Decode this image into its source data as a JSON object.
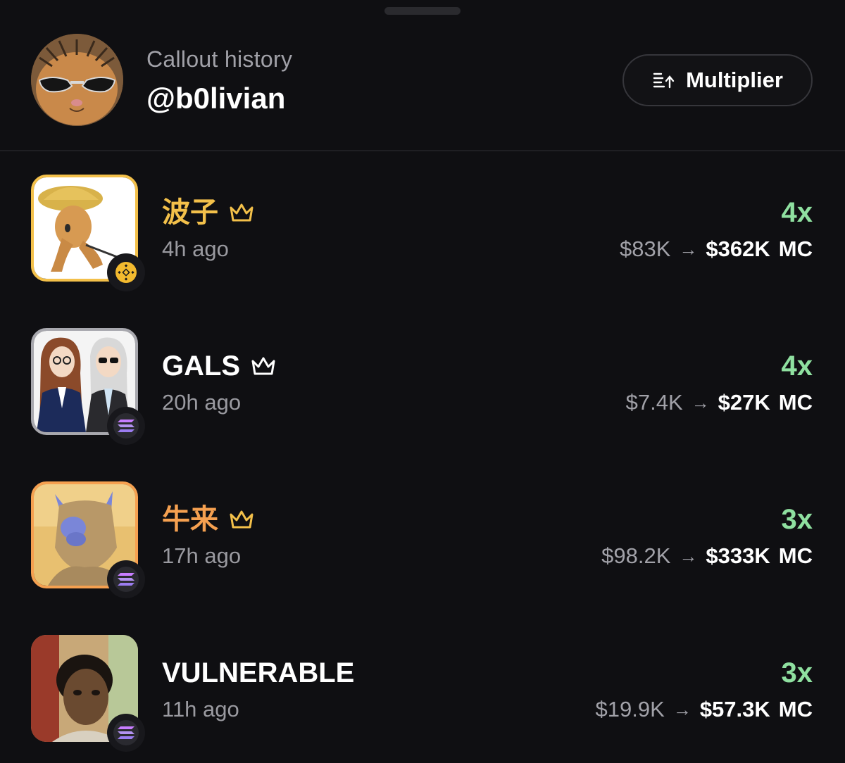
{
  "header": {
    "subtitle": "Callout history",
    "username": "@b0livian",
    "multiplier_button": "Multiplier"
  },
  "colors": {
    "background": "#0f0f12",
    "accent_green": "#8fe0a0",
    "gold": "#f3c04a",
    "orange": "#f5a050",
    "muted_text": "#9a9aa0"
  },
  "callouts": [
    {
      "name": "波子",
      "crown": true,
      "name_color": "#f3c04a",
      "border_color": "#f3c04a",
      "chain": "bnb-icon",
      "time": "4h ago",
      "multiplier": "4x",
      "mc_from": "$83K",
      "mc_to": "$362K",
      "mc_unit": "MC"
    },
    {
      "name": "GALS",
      "crown": true,
      "name_color": "#ffffff",
      "border_color": "#a8a8ae",
      "chain": "solana-icon",
      "time": "20h ago",
      "multiplier": "4x",
      "mc_from": "$7.4K",
      "mc_to": "$27K",
      "mc_unit": "MC"
    },
    {
      "name": "牛来",
      "crown": true,
      "name_color": "#f5a050",
      "border_color": "#f5a050",
      "chain": "solana-icon",
      "time": "17h ago",
      "multiplier": "3x",
      "mc_from": "$98.2K",
      "mc_to": "$333K",
      "mc_unit": "MC"
    },
    {
      "name": "VULNERABLE",
      "crown": false,
      "name_color": "#ffffff",
      "border_color": "none",
      "chain": "solana-icon",
      "time": "11h ago",
      "multiplier": "3x",
      "mc_from": "$19.9K",
      "mc_to": "$57.3K",
      "mc_unit": "MC"
    }
  ]
}
